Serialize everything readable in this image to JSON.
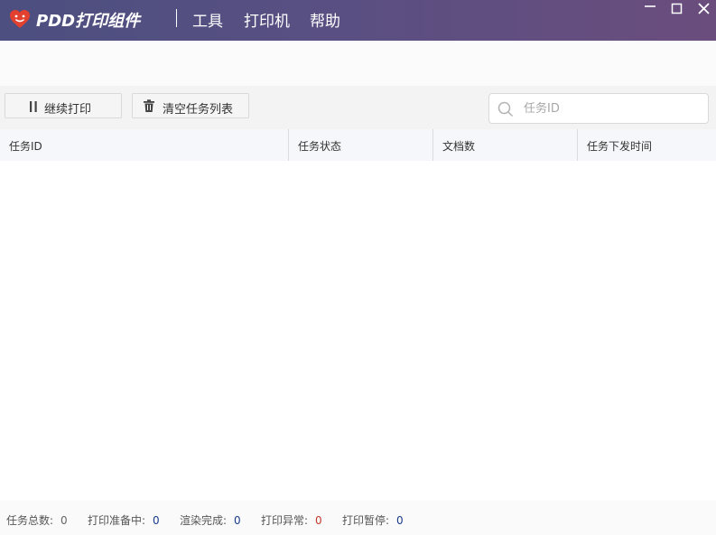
{
  "titlebar": {
    "app_title": "PDD打印组件",
    "menu": [
      {
        "label": "工具"
      },
      {
        "label": "打印机"
      },
      {
        "label": "帮助"
      }
    ],
    "gradient_colors": [
      "#4c4f80",
      "#6a4d7d"
    ]
  },
  "toolbar": {
    "continue_label": "继续打印",
    "clear_label": "清空任务列表",
    "search_placeholder": "任务ID",
    "search_value": ""
  },
  "table": {
    "columns": [
      {
        "label": "任务ID"
      },
      {
        "label": "任务状态"
      },
      {
        "label": "文档数"
      },
      {
        "label": "任务下发时间"
      }
    ],
    "rows": []
  },
  "statusbar": {
    "items": [
      {
        "label": "任务总数:",
        "value": "0",
        "color": "#666666"
      },
      {
        "label": "打印准备中:",
        "value": "0",
        "color": "#1a3c8c"
      },
      {
        "label": "渲染完成:",
        "value": "0",
        "color": "#1a3c8c"
      },
      {
        "label": "打印异常:",
        "value": "0",
        "color": "#c0392b"
      },
      {
        "label": "打印暂停:",
        "value": "0",
        "color": "#1a3c8c"
      }
    ]
  },
  "icons": {
    "logo": "pdd-heart-logo-icon",
    "pause": "pause-icon",
    "trash": "trash-icon",
    "search": "search-icon",
    "minimize": "minimize-icon",
    "maximize": "maximize-icon",
    "close": "close-icon"
  }
}
